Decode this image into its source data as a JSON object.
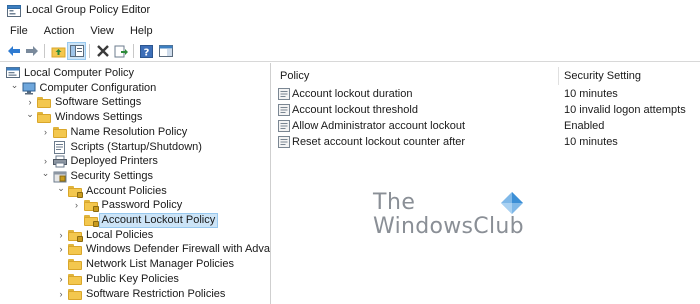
{
  "window": {
    "title": "Local Group Policy Editor",
    "icon": "group-policy-icon"
  },
  "menubar": {
    "items": [
      "File",
      "Action",
      "View",
      "Help"
    ]
  },
  "toolbar": {
    "icons": [
      "back-arrow-icon",
      "forward-arrow-icon",
      "up-folder-icon",
      "show-hide-tree-icon",
      "delete-x-icon",
      "export-list-icon",
      "help-icon",
      "properties-pane-icon"
    ]
  },
  "tree": {
    "nodes": [
      {
        "label": "Local Computer Policy",
        "icon": "computer-policy-icon",
        "level": 0
      },
      {
        "label": "Computer Configuration",
        "icon": "computer-icon",
        "level": 1,
        "expanded": true
      },
      {
        "label": "Software Settings",
        "icon": "folder-icon",
        "level": 2,
        "expanded": false
      },
      {
        "label": "Windows Settings",
        "icon": "folder-icon",
        "level": 2,
        "expanded": true
      },
      {
        "label": "Name Resolution Policy",
        "icon": "folder-icon",
        "level": 3,
        "expanded": false
      },
      {
        "label": "Scripts (Startup/Shutdown)",
        "icon": "script-icon",
        "level": 3
      },
      {
        "label": "Deployed Printers",
        "icon": "printer-icon",
        "level": 3,
        "expanded": false
      },
      {
        "label": "Security Settings",
        "icon": "security-settings-icon",
        "level": 3,
        "expanded": true
      },
      {
        "label": "Account Policies",
        "icon": "locked-folder-icon",
        "level": 4,
        "expanded": true
      },
      {
        "label": "Password Policy",
        "icon": "locked-folder-icon",
        "level": 5,
        "expanded": false
      },
      {
        "label": "Account Lockout Policy",
        "icon": "locked-folder-icon",
        "level": 5,
        "selected": true
      },
      {
        "label": "Local Policies",
        "icon": "locked-folder-icon",
        "level": 4,
        "expanded": false
      },
      {
        "label": "Windows Defender Firewall with Advanced",
        "icon": "folder-icon",
        "level": 4,
        "expanded": false
      },
      {
        "label": "Network List Manager Policies",
        "icon": "folder-icon",
        "level": 4
      },
      {
        "label": "Public Key Policies",
        "icon": "folder-icon",
        "level": 4,
        "expanded": false
      },
      {
        "label": "Software Restriction Policies",
        "icon": "folder-icon",
        "level": 4,
        "expanded": false
      }
    ]
  },
  "list": {
    "columns": [
      "Policy",
      "Security Setting"
    ],
    "rows": [
      {
        "policy": "Account lockout duration",
        "setting": "10 minutes"
      },
      {
        "policy": "Account lockout threshold",
        "setting": "10 invalid logon attempts"
      },
      {
        "policy": "Allow Administrator account lockout",
        "setting": "Enabled"
      },
      {
        "policy": "Reset account lockout counter after",
        "setting": "10 minutes"
      }
    ]
  },
  "watermark": {
    "line1": "The",
    "line2": "WindowsClub"
  },
  "colors": {
    "selection": "#cce4f7",
    "folder": "#f3c74e"
  }
}
